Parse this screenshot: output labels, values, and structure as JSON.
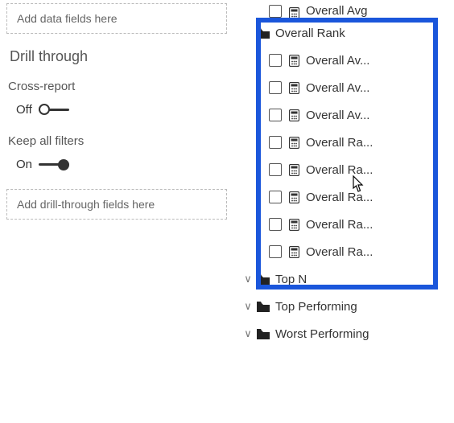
{
  "left": {
    "dropzone_data": "Add data fields here",
    "drill_title": "Drill through",
    "cross_report_label": "Cross-report",
    "cross_report_state": "Off",
    "keep_filters_label": "Keep all filters",
    "keep_filters_state": "On",
    "dropzone_drill": "Add drill-through fields here"
  },
  "right": {
    "partial_top": "Overall Avg",
    "highlighted_folder": "Overall Rank",
    "highlighted_children": [
      "Overall Av...",
      "Overall Av...",
      "Overall Av...",
      "Overall Ra...",
      "Overall Ra...",
      "Overall Ra...",
      "Overall Ra...",
      "Overall Ra..."
    ],
    "folders_after": [
      {
        "label": "Top N",
        "expanded": false
      },
      {
        "label": "Top Performing",
        "expanded": false
      },
      {
        "label": "Worst Performing",
        "expanded": false
      }
    ]
  }
}
